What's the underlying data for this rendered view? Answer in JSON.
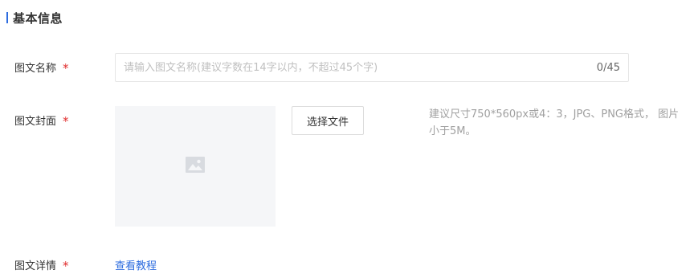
{
  "section": {
    "title": "基本信息"
  },
  "colors": {
    "accent": "#2d6cdf",
    "required": "#e02d2d",
    "placeholder": "#c0c0c0",
    "hint": "#a0a0a0",
    "cover_bg": "#f5f6f8"
  },
  "fields": {
    "title": {
      "label": "图文名称",
      "required_mark": "*",
      "placeholder": "请输入图文名称(建议字数在14字以内，不超过45个字)",
      "value": "",
      "counter": "0/45"
    },
    "cover": {
      "label": "图文封面",
      "required_mark": "*",
      "placeholder_icon": "image-icon",
      "button_label": "选择文件",
      "hint": "建议尺寸750*560px或4：3，JPG、PNG格式， 图片小于5M。"
    },
    "detail": {
      "label": "图文详情",
      "required_mark": "*",
      "link_text": "查看教程"
    }
  }
}
